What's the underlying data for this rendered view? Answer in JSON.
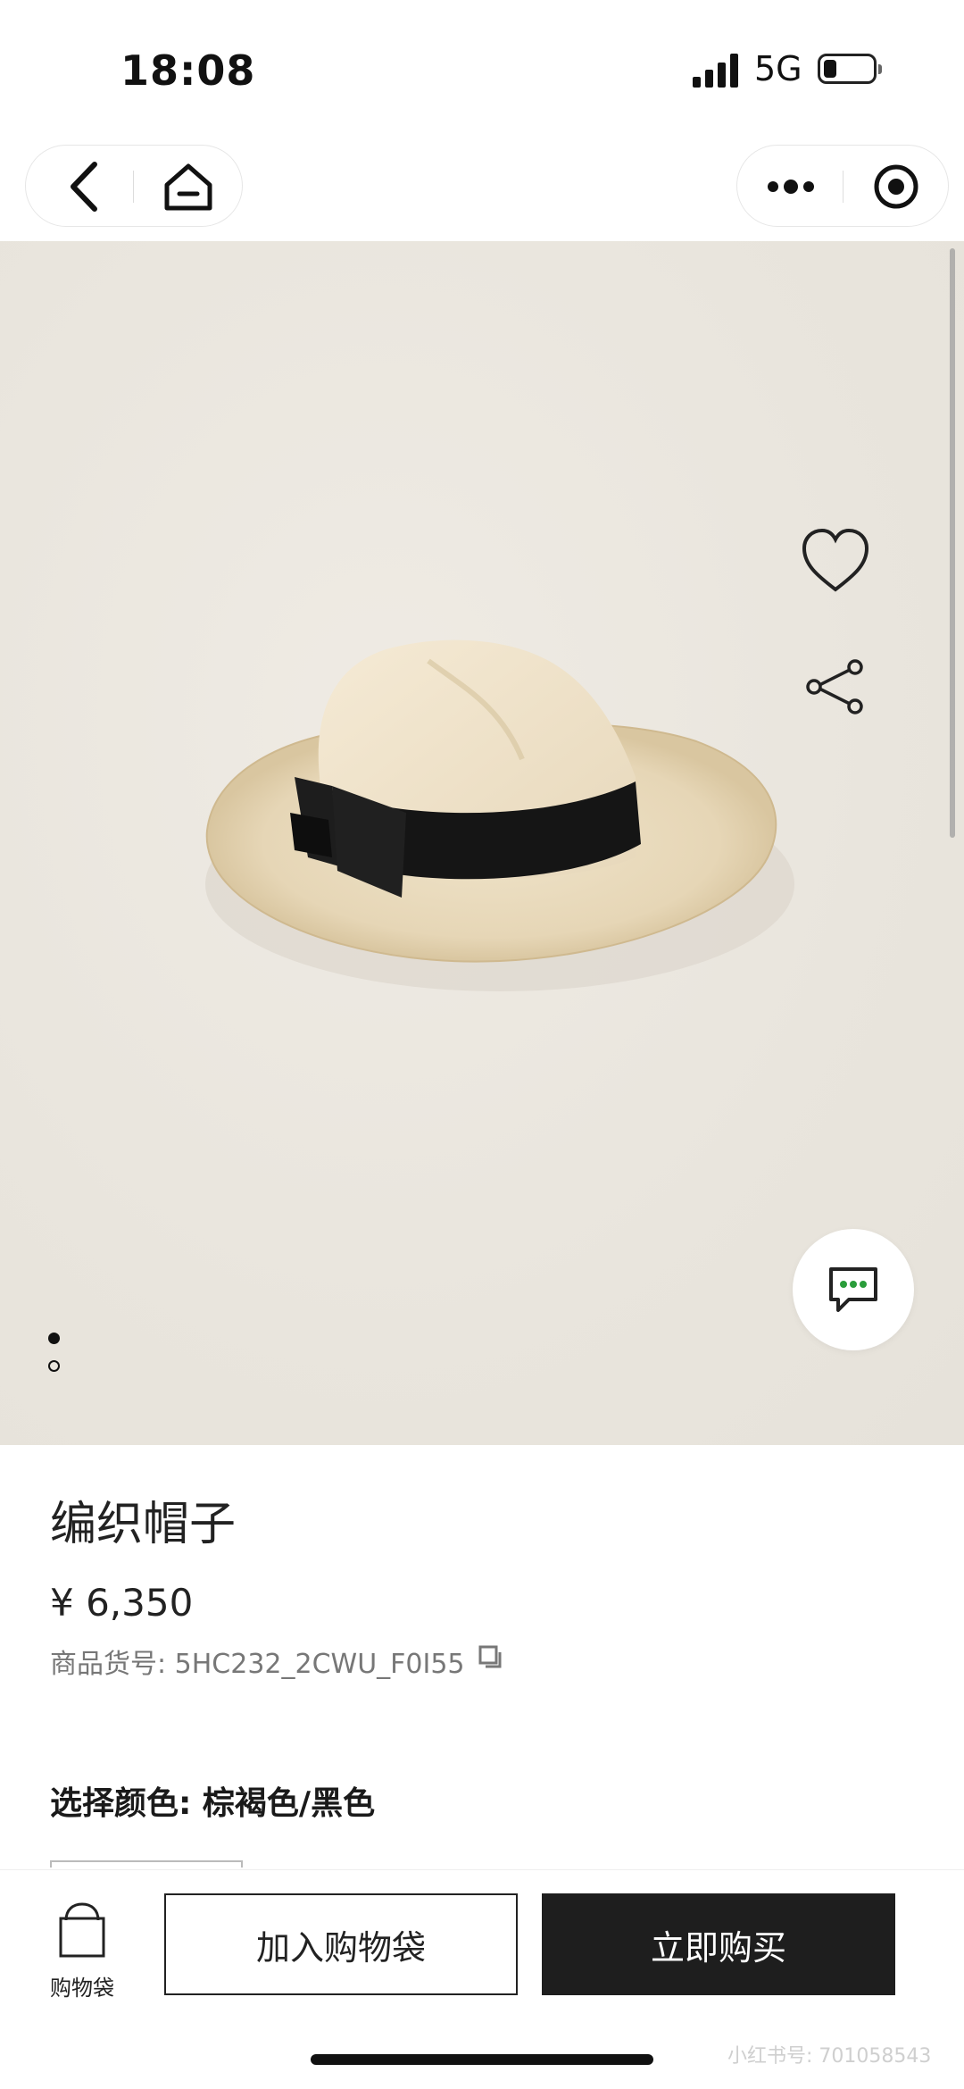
{
  "status": {
    "time": "18:08",
    "network": "5G"
  },
  "nav": {
    "back_icon": "chevron-left-icon",
    "home_icon": "home-icon",
    "more_icon": "more-dots-icon",
    "close_icon": "target-circle-icon"
  },
  "hero": {
    "image": "straw-fedora-hat-with-black-ribbon",
    "favorite_icon": "heart-icon",
    "share_icon": "share-icon",
    "chat_icon": "chat-bubble-icon",
    "slides": 2,
    "active_slide": 1
  },
  "product": {
    "title": "编织帽子",
    "price": "¥ 6,350",
    "sku": "商品货号: 5HC232_2CWU_F0I55",
    "color_label": "选择颜色: 棕褐色/黑色"
  },
  "bottom": {
    "bag_label": "购物袋",
    "add_to_bag": "加入购物袋",
    "buy_now": "立即购买"
  },
  "watermark": "小红书号: 701058543",
  "colors": {
    "accent_dark": "#1e1e1e",
    "hero_bg": "#e9e5dd",
    "chat_dots": "#2a9d3a"
  }
}
